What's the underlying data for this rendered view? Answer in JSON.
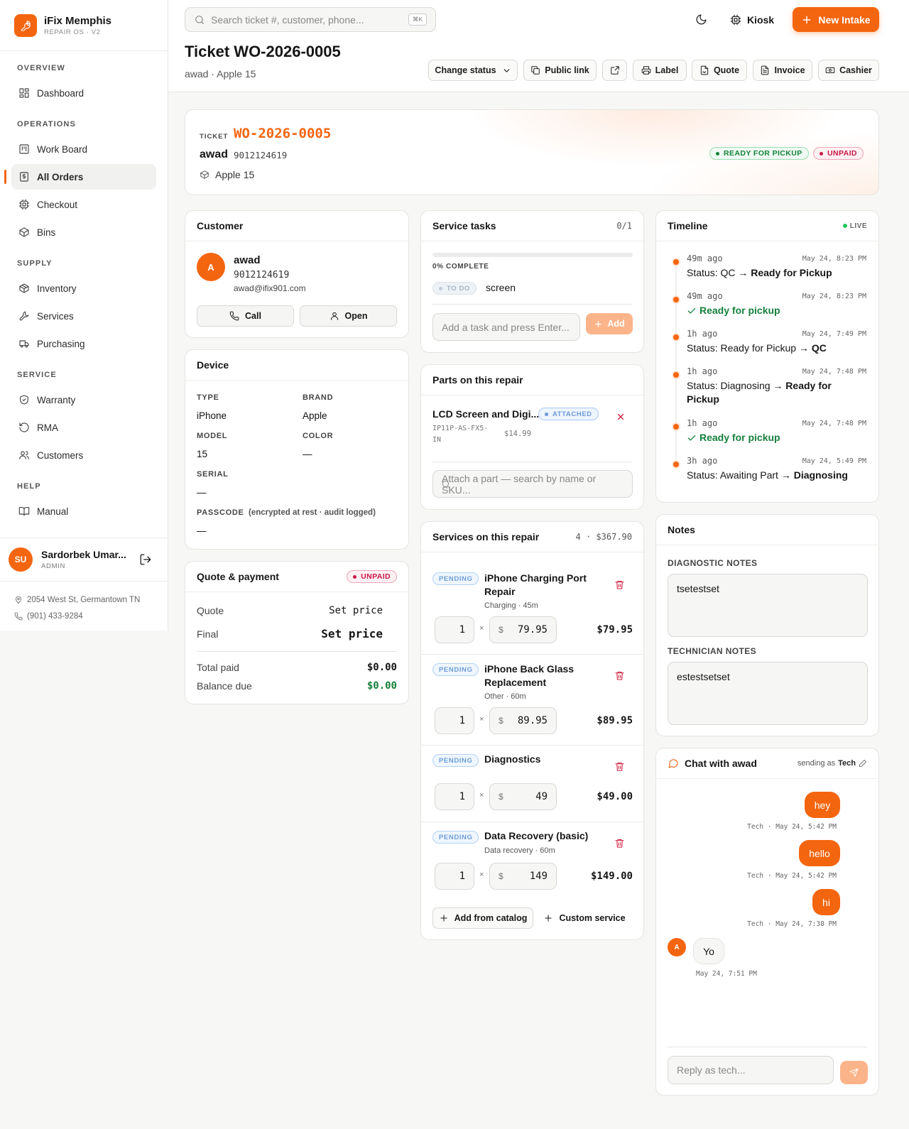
{
  "brand": {
    "name": "iFix Memphis",
    "subtitle": "REPAIR OS · V2"
  },
  "nav": {
    "overview": {
      "title": "OVERVIEW",
      "items": [
        "Dashboard"
      ]
    },
    "operations": {
      "title": "OPERATIONS",
      "items": [
        "Work Board",
        "All Orders",
        "Checkout",
        "Bins"
      ]
    },
    "supply": {
      "title": "SUPPLY",
      "items": [
        "Inventory",
        "Services",
        "Purchasing"
      ]
    },
    "service": {
      "title": "SERVICE",
      "items": [
        "Warranty",
        "RMA",
        "Customers"
      ]
    },
    "help": {
      "title": "HELP",
      "items": [
        "Manual"
      ]
    },
    "active": "All Orders"
  },
  "user": {
    "initials": "SU",
    "name": "Sardorbek Umar...",
    "role": "ADMIN"
  },
  "store": {
    "address": "2054 West St, Germantown TN",
    "phone": "(901) 433-9284"
  },
  "header": {
    "search_placeholder": "Search ticket #, customer, phone...",
    "search_kbd": "⌘K",
    "kiosk": "Kiosk",
    "new_intake": "New Intake",
    "title": "Ticket WO-2026-0005",
    "subtitle": "awad · Apple 15",
    "actions": [
      "Change status",
      "Public link",
      "Label",
      "Quote",
      "Invoice",
      "Cashier"
    ]
  },
  "hero": {
    "label": "TICKET",
    "number": "WO-2026-0005",
    "customer": "awad",
    "phone": "9012124619",
    "device": "Apple 15",
    "status": "READY FOR PICKUP",
    "payment": "UNPAID",
    "accent": "#f4650f"
  },
  "customer": {
    "title": "Customer",
    "initial": "A",
    "name": "awad",
    "phone": "9012124619",
    "email": "awad@ifix901.com",
    "call": "Call",
    "open": "Open"
  },
  "device": {
    "title": "Device",
    "type_label": "TYPE",
    "type": "iPhone",
    "brand_label": "BRAND",
    "brand": "Apple",
    "model_label": "MODEL",
    "model": "15",
    "color_label": "COLOR",
    "color": "—",
    "serial_label": "SERIAL",
    "serial": "—",
    "passcode_label": "PASSCODE",
    "passcode_note": "(encrypted at rest · audit logged)",
    "passcode": "—"
  },
  "quote": {
    "title": "Quote & payment",
    "badge": "UNPAID",
    "quote_label": "Quote",
    "quote_value": "Set price",
    "final_label": "Final",
    "final_value": "Set price",
    "paid_label": "Total paid",
    "paid_value": "$0.00",
    "balance_label": "Balance due",
    "balance_value": "$0.00"
  },
  "tasks": {
    "title": "Service tasks",
    "count": "0/1",
    "progress": 0,
    "progress_label": "0% COMPLETE",
    "items": [
      {
        "status": "TO DO",
        "name": "screen"
      }
    ],
    "placeholder": "Add a task and press Enter...",
    "add": "Add"
  },
  "parts": {
    "title": "Parts on this repair",
    "items": [
      {
        "name": "LCD Screen and Digi...",
        "badge": "ATTACHED",
        "sku_line1": "IP11P-AS-FX5-",
        "sku_line2": "IN",
        "price": "$14.99"
      }
    ],
    "placeholder": "Attach a part — search by name or SKU..."
  },
  "services": {
    "title": "Services on this repair",
    "summary": "4 · $367.90",
    "items": [
      {
        "status": "PENDING",
        "name_line1": "iPhone Charging Port",
        "name_line2": "Repair",
        "meta": "Charging · 45m",
        "qty": "1",
        "price": "79.95",
        "total": "$79.95"
      },
      {
        "status": "PENDING",
        "name_line1": "iPhone Back Glass",
        "name_line2": "Replacement",
        "meta": "Other · 60m",
        "qty": "1",
        "price": "89.95",
        "total": "$89.95"
      },
      {
        "status": "PENDING",
        "name_line1": "Diagnostics",
        "name_line2": "",
        "meta": "",
        "qty": "1",
        "price": "49",
        "total": "$49.00"
      },
      {
        "status": "PENDING",
        "name_line1": "Data Recovery (basic)",
        "name_line2": "",
        "meta": "Data recovery · 60m",
        "qty": "1",
        "price": "149",
        "total": "$149.00"
      }
    ],
    "currency": "$",
    "times": "×",
    "add_catalog": "Add from catalog",
    "custom": "Custom service"
  },
  "timeline": {
    "title": "Timeline",
    "live": "LIVE",
    "items": [
      {
        "ago": "49m ago",
        "date": "May 24, 8:23 PM",
        "prefix": "Status: QC → ",
        "bold": "Ready for Pickup"
      },
      {
        "ago": "49m ago",
        "date": "May 24, 8:23 PM",
        "check": "Ready for pickup"
      },
      {
        "ago": "1h ago",
        "date": "May 24, 7:49 PM",
        "prefix": "Status: Ready for Pickup → ",
        "bold": "QC"
      },
      {
        "ago": "1h ago",
        "date": "May 24, 7:48 PM",
        "prefix": "Status: Diagnosing → ",
        "bold": "Ready for Pickup"
      },
      {
        "ago": "1h ago",
        "date": "May 24, 7:48 PM",
        "check": "Ready for pickup"
      },
      {
        "ago": "3h ago",
        "date": "May 24, 5:49 PM",
        "prefix": "Status: Awaiting Part → ",
        "bold": "Diagnosing"
      }
    ]
  },
  "notes": {
    "title": "Notes",
    "diag_label": "DIAGNOSTIC NOTES",
    "diag": "tsetestset",
    "tech_label": "TECHNICIAN NOTES",
    "tech": "estestsetset"
  },
  "chat": {
    "title": "Chat with awad",
    "sending_as": "sending as",
    "sender": "Tech",
    "messages": [
      {
        "text": "hey",
        "meta": "Tech · May 24, 5:42 PM"
      },
      {
        "text": "hello",
        "meta": "Tech · May 24, 5:42 PM"
      },
      {
        "text": "hi",
        "meta": "Tech · May 24, 7:38 PM"
      },
      {
        "text": "Yo",
        "meta": "May 24, 7:51 PM",
        "initial": "A"
      }
    ],
    "placeholder": "Reply as tech..."
  }
}
